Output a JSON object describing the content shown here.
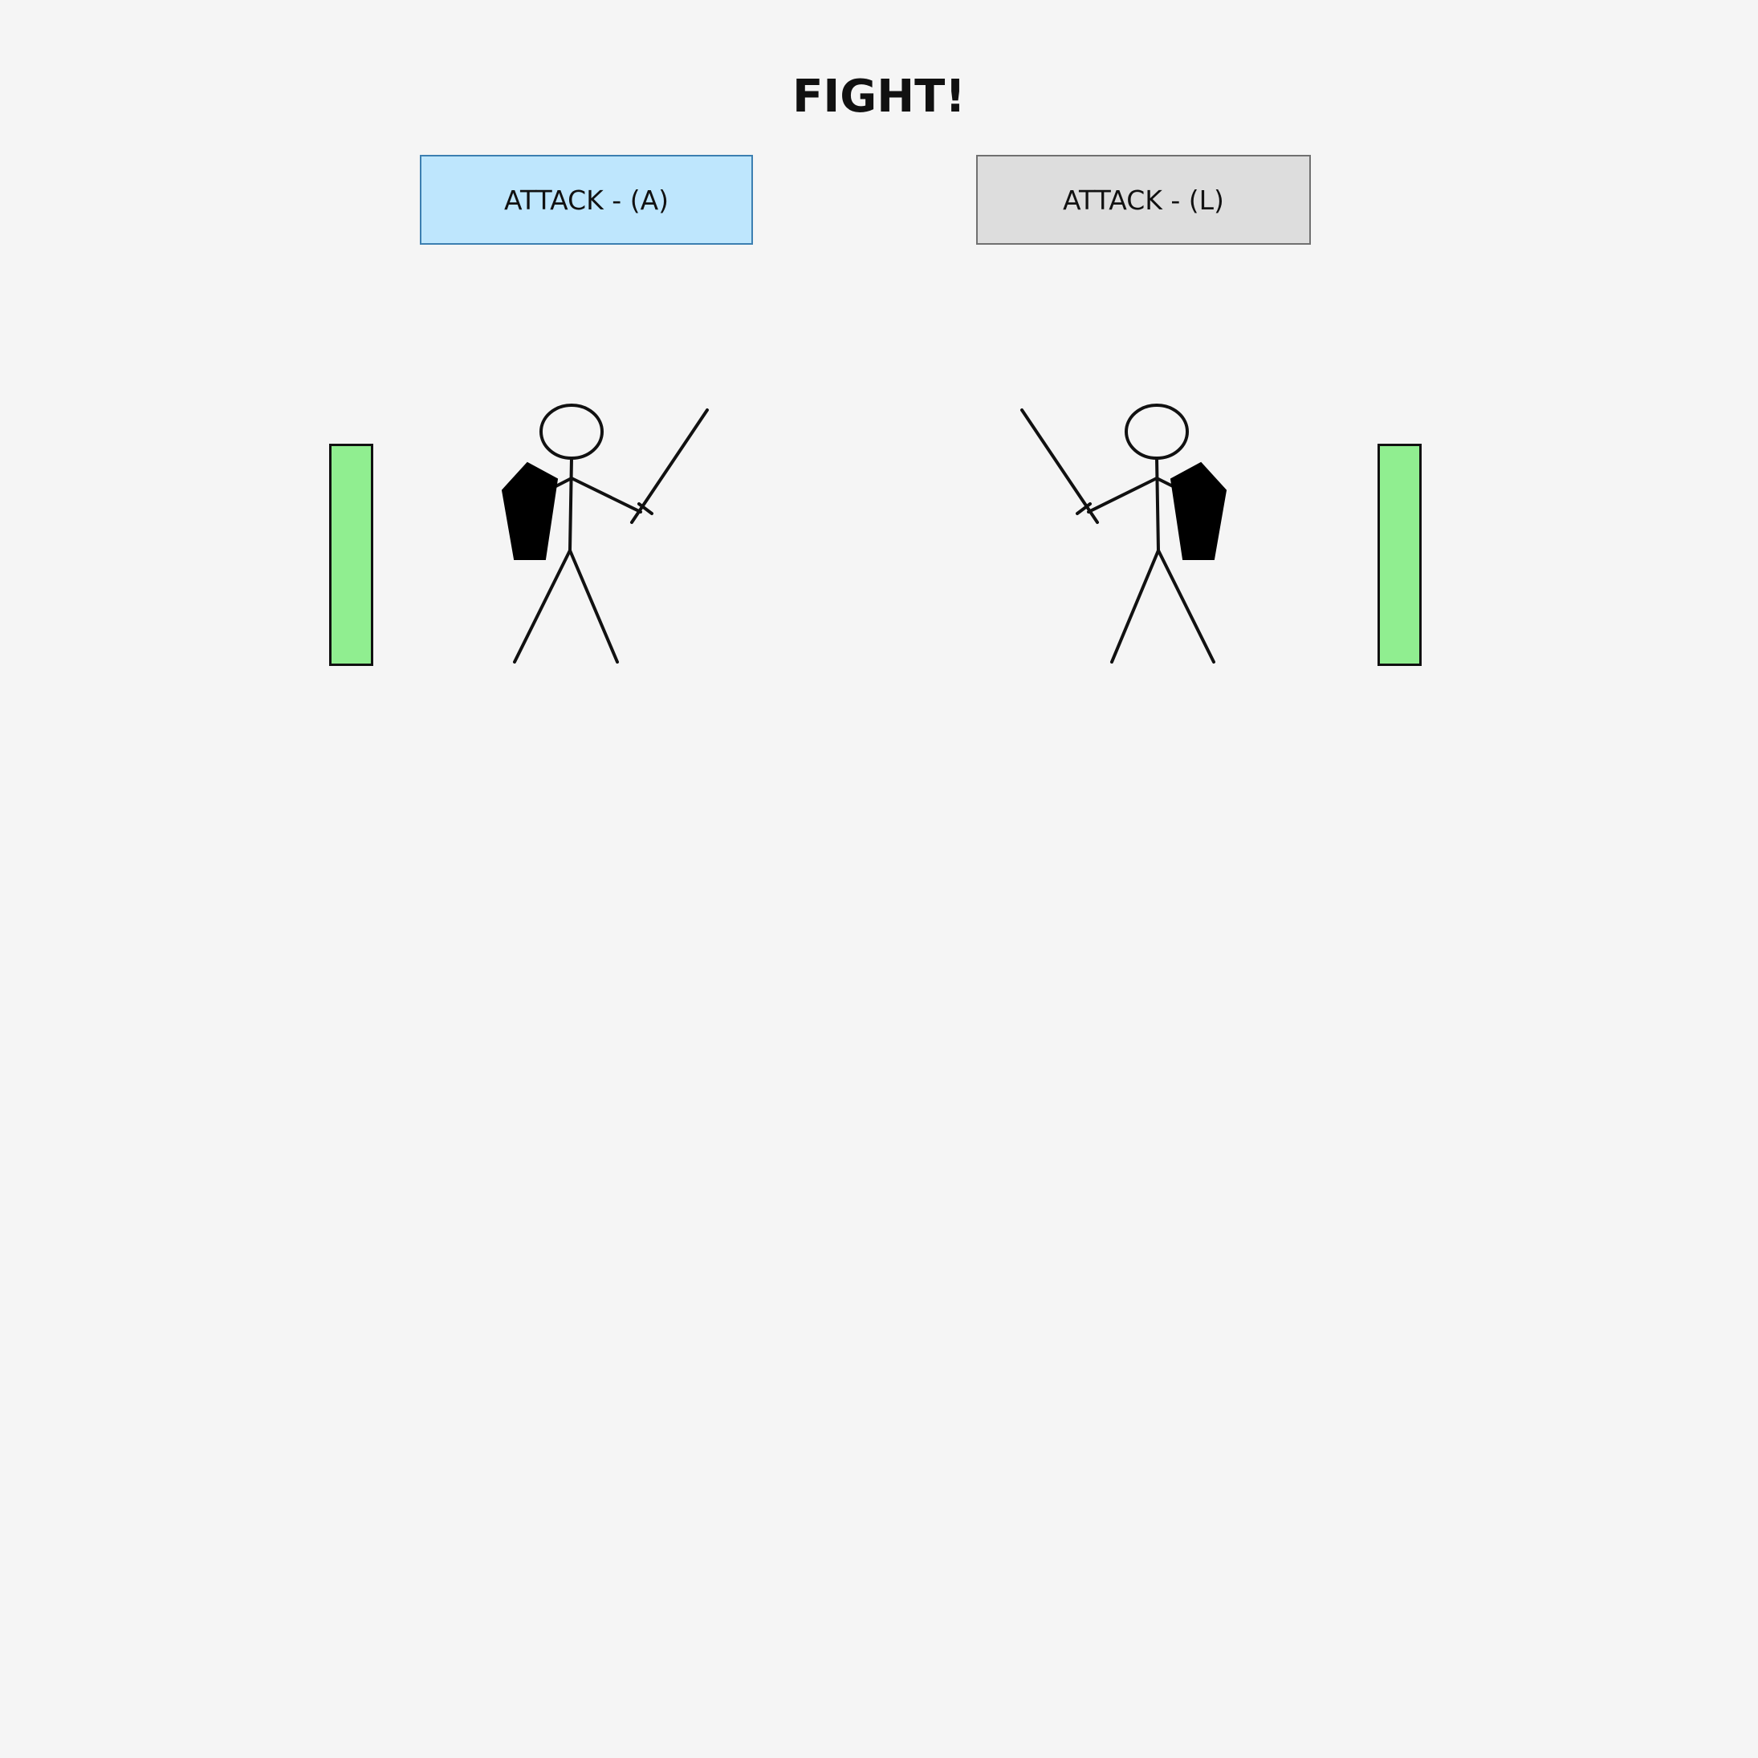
{
  "title": "FIGHT!",
  "players": [
    {
      "attack_label": "ATTACK - (A)",
      "health": 1.0,
      "health_color": "#90ee90"
    },
    {
      "attack_label": "ATTACK - (L)",
      "health": 1.0,
      "health_color": "#90ee90"
    }
  ],
  "icons": {
    "left_fighter": "stick-figure-sword-shield",
    "right_fighter": "stick-figure-sword-shield"
  }
}
